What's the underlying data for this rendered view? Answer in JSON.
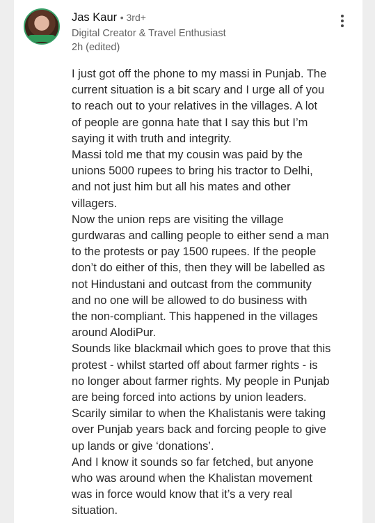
{
  "post": {
    "author": {
      "name": "Jas Kaur",
      "degree": "• 3rd+",
      "headline": "Digital Creator & Travel Enthusiast",
      "time": "2h (edited)",
      "avatar_icon": "profile-photo"
    },
    "menu_icon": "more-vertical-icon",
    "body_lines": [
      "I just got off the phone to my massi in Punjab. The",
      "current situation is a bit scary and I urge all of you",
      "to reach out to your relatives in the villages. A lot",
      "of people are gonna hate that I say this but I’m",
      "saying it with truth and integrity.",
      "Massi told me that my cousin was paid by the",
      "unions 5000 rupees to bring his tractor to Delhi,",
      "and not just him but all his mates and other",
      "villagers.",
      "Now the union reps are visiting the village",
      "gurdwaras and calling people to either send a man",
      "to the protests or pay 1500 rupees. If the people",
      "don’t do either of this, then they will be labelled as",
      "not Hindustani and outcast from the community",
      "and no one will be allowed to do business with",
      "the non-compliant. This happened in the villages",
      "around AlodiPur.",
      "Sounds like blackmail which goes to prove that this",
      "protest - whilst started off about farmer rights - is",
      "no longer about farmer rights. My people in Punjab",
      "are being forced into actions by union leaders.",
      "Scarily similar to when the Khalistanis were taking",
      "over Punjab years back and forcing people to give",
      "up lands or give ‘donations’.",
      "And I know it sounds so far fetched, but anyone",
      "who was around when the Khalistan movement",
      "was in force would know that it’s a very real",
      "situation."
    ]
  },
  "colors": {
    "accent_ring": "#38a169",
    "text_primary": "#2a2a2a",
    "text_secondary": "#616161"
  }
}
